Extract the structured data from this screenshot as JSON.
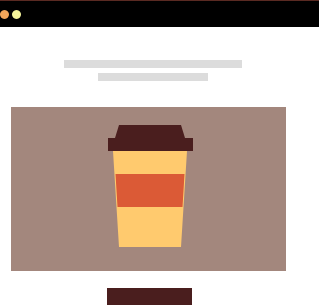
{
  "window": {
    "controls": [
      {
        "name": "window-dot-orange",
        "color": "#f2a65a"
      },
      {
        "name": "window-dot-yellow",
        "color": "#f4f39a"
      }
    ],
    "bar_color": "#000000"
  },
  "header": {
    "placeholder_color": "#dcdcdc"
  },
  "hero": {
    "icon": "coffee-cup-icon",
    "background_color": "#a3877d",
    "cup": {
      "lid_color": "#4a1e1e",
      "body_color": "#ffca6e",
      "band_color": "#db5a36"
    }
  },
  "cta": {
    "label": "",
    "color": "#4a1e1e"
  }
}
